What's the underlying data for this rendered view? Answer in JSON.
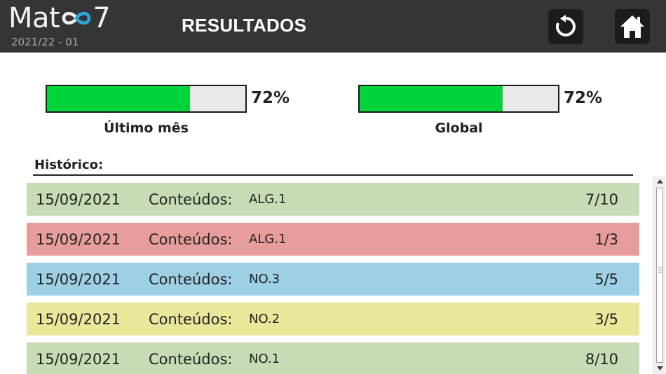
{
  "app": {
    "logo_prefix": "Mat",
    "logo_suffix": "7",
    "version": "2021/22 - 01",
    "page_title": "RESULTADOS"
  },
  "header_buttons": {
    "reset_icon": "refresh-icon",
    "home_icon": "home-icon"
  },
  "progress": [
    {
      "label": "Último mês",
      "percent_text": "72%",
      "value": 0.72
    },
    {
      "label": "Global",
      "percent_text": "72%",
      "value": 0.72
    }
  ],
  "colors": {
    "topbar": "#333536",
    "progress_fill": "#00d43a",
    "progress_track": "#e9e9e9",
    "row_green": "#c7dbb4",
    "row_red": "#e89d9d",
    "row_blue": "#9dcfe5",
    "row_yellow": "#e8e79a"
  },
  "history": {
    "title": "Histórico:",
    "rows": [
      {
        "date": "15/09/2021",
        "label": "Conteúdos:",
        "code": "ALG.1",
        "score": "7/10",
        "color": "#c7dbb4"
      },
      {
        "date": "15/09/2021",
        "label": "Conteúdos:",
        "code": "ALG.1",
        "score": "1/3",
        "color": "#e89d9d"
      },
      {
        "date": "15/09/2021",
        "label": "Conteúdos:",
        "code": "NO.3",
        "score": "5/5",
        "color": "#9dcfe5"
      },
      {
        "date": "15/09/2021",
        "label": "Conteúdos:",
        "code": "NO.2",
        "score": "3/5",
        "color": "#e8e79a"
      },
      {
        "date": "15/09/2021",
        "label": "Conteúdos:",
        "code": "NO.1",
        "score": "8/10",
        "color": "#c7dbb4"
      }
    ]
  }
}
